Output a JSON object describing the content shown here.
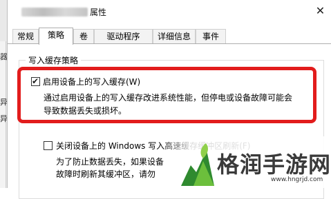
{
  "window": {
    "title_suffix": "属性",
    "close_glyph": "✕"
  },
  "tabs": [
    {
      "label": "常规",
      "active": false
    },
    {
      "label": "策略",
      "active": true
    },
    {
      "label": "卷",
      "active": false
    },
    {
      "label": "驱动程序",
      "active": false
    },
    {
      "label": "详细信息",
      "active": false
    },
    {
      "label": "事件",
      "active": false
    }
  ],
  "group": {
    "caption": "写入缓存策略",
    "enable_cache": {
      "label": "启用设备上的写入缓存(W)",
      "checked": true,
      "description_line1": "通过启用设备上的写入缓存改进系统性能，但停电或设备故障可能会",
      "description_line2": "导致数据丢失或损坏。"
    },
    "flush_option": {
      "label": "关闭设备上的 Windows 写入高速缓存缓冲区刷新(F)",
      "checked": false,
      "description_line1": "为了防止数据丢失，如果设备",
      "description_line2": "故障时刷新其缓冲区，请勿"
    }
  },
  "left_edge_glyphs": [
    "器",
    "异",
    "异"
  ],
  "watermark": {
    "brand": "格润手游网",
    "url": "www.hngrjd.com"
  },
  "colors": {
    "highlight_red": "#e21c1c",
    "tab_border": "#adadad",
    "watermark_green": "#2f8a2f"
  }
}
